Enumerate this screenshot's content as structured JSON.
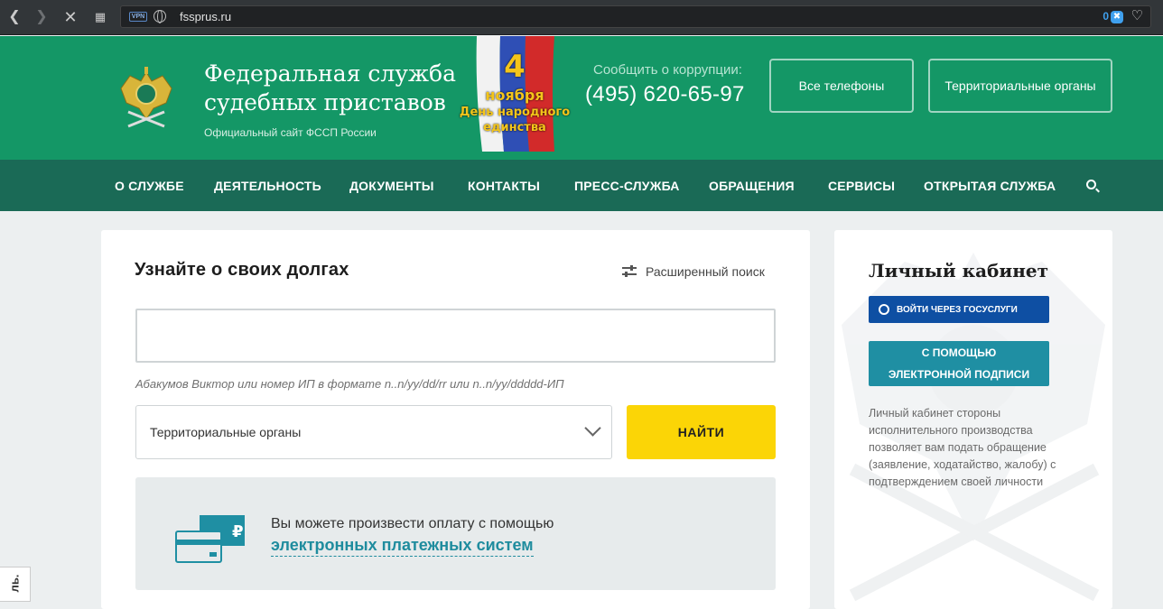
{
  "browser": {
    "url": "fssprus.ru",
    "vpn_label": "VPN",
    "block_count": "0"
  },
  "header": {
    "title_line1": "Федеральная служба",
    "title_line2": "судебных приставов",
    "subtitle": "Официальный сайт ФССП России",
    "holiday_day": "4",
    "holiday_month": "ноября",
    "holiday_line1": "День народного",
    "holiday_line2": "единства",
    "corruption_label": "Сообщить о коррупции:",
    "corruption_phone": "(495) 620-65-97",
    "all_phones": "Все телефоны",
    "territorial": "Территориальные органы",
    "colors": {
      "header_bg": "#149766",
      "nav_bg": "#1a6a56"
    }
  },
  "nav": {
    "items": [
      "О СЛУЖБЕ",
      "ДЕЯТЕЛЬНОСТЬ",
      "ДОКУМЕНТЫ",
      "КОНТАКТЫ",
      "ПРЕСС-СЛУЖБА",
      "ОБРАЩЕНИЯ",
      "СЕРВИСЫ",
      "ОТКРЫТАЯ СЛУЖБА"
    ]
  },
  "debt": {
    "title": "Узнайте о своих долгах",
    "advanced_search": "Расширенный поиск",
    "search_value": "",
    "hint": "Абакумов Виктор или номер ИП в формате n..n/yy/dd/rr или n..n/yy/ddddd-ИП",
    "region_value": "Территориальные органы",
    "find_label": "НАЙТИ",
    "pay_text": "Вы можете произвести оплату с помощью",
    "pay_link": "электронных платежных систем",
    "card_currency": "₽"
  },
  "cabinet": {
    "title": "Личный кабинет",
    "gosuslugi": "ВОЙТИ ЧЕРЕЗ ГОСУСЛУГИ",
    "signature_line1": "С ПОМОЩЬЮ",
    "signature_line2": "ЭЛЕКТРОННОЙ ПОДПИСИ",
    "description": "Личный кабинет стороны исполнительного производства позволяет вам подать обращение (заявление, ходатайство, жалобу) с подтверждением своей личности"
  },
  "edge_tab_label": "ль."
}
